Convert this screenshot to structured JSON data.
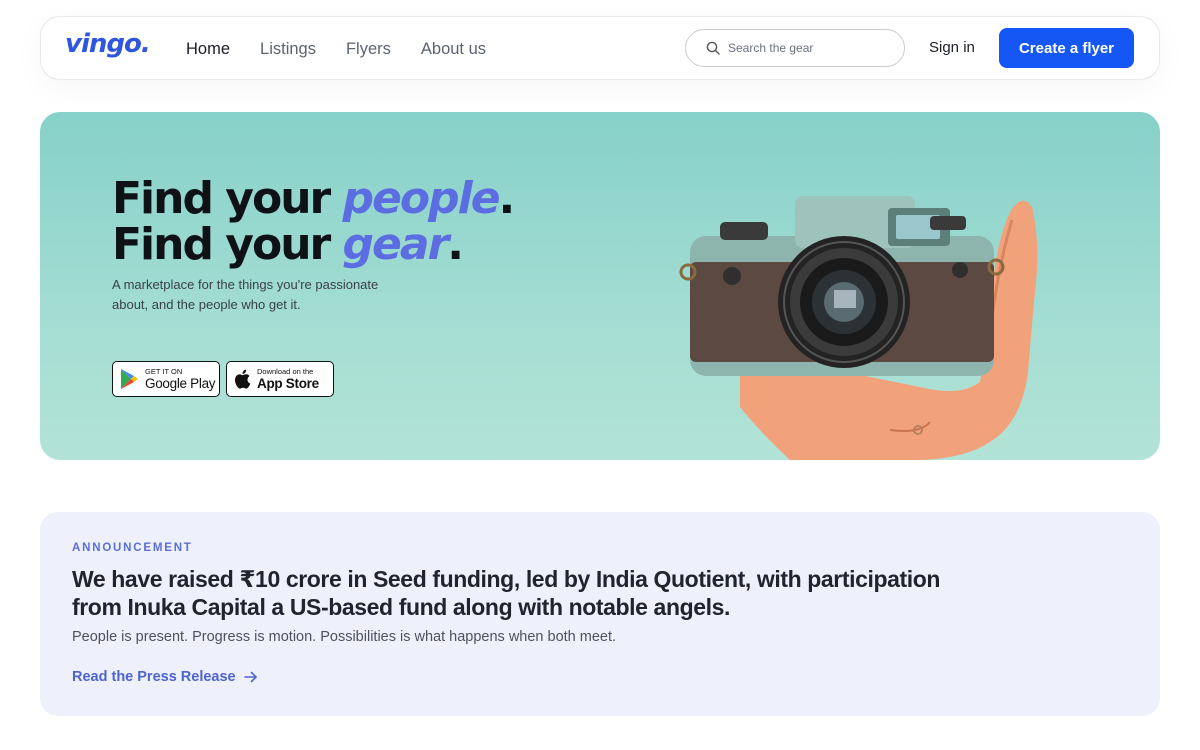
{
  "brand": {
    "logo": "vingo.",
    "accent": "#1557f5",
    "brand_blue": "#2f56e0"
  },
  "nav": {
    "links": [
      {
        "label": "Home",
        "active": true
      },
      {
        "label": "Listings",
        "active": false
      },
      {
        "label": "Flyers",
        "active": false
      },
      {
        "label": "About us",
        "active": false
      }
    ],
    "search": {
      "placeholder": "Search the gear",
      "icon": "search-icon"
    },
    "sign_in": "Sign in",
    "cta": "Create a flyer"
  },
  "hero": {
    "line1_prefix": "Find your",
    "line1_accent": "people",
    "line1_suffix": ".",
    "line2_prefix": "Find your",
    "line2_accent": "gear",
    "line2_suffix": ".",
    "subtitle": "A marketplace for the things you're passionate about, and the people who get it.",
    "google_play": {
      "small": "GET IT ON",
      "big": "Google Play",
      "icon": "google-play-icon"
    },
    "app_store": {
      "small": "Download on the",
      "big": "App Store",
      "icon": "apple-icon"
    },
    "image": "hand-holding-camera"
  },
  "announcement": {
    "label": "ANNOUNCEMENT",
    "headline": "We have raised ₹10 crore in Seed funding, led by India Quotient, with participation from Inuka Capital a US-based fund along with notable angels.",
    "body": "People is present. Progress is motion. Possibilities is what happens when both meet.",
    "link": "Read the Press Release",
    "link_icon": "arrow-right-icon"
  }
}
